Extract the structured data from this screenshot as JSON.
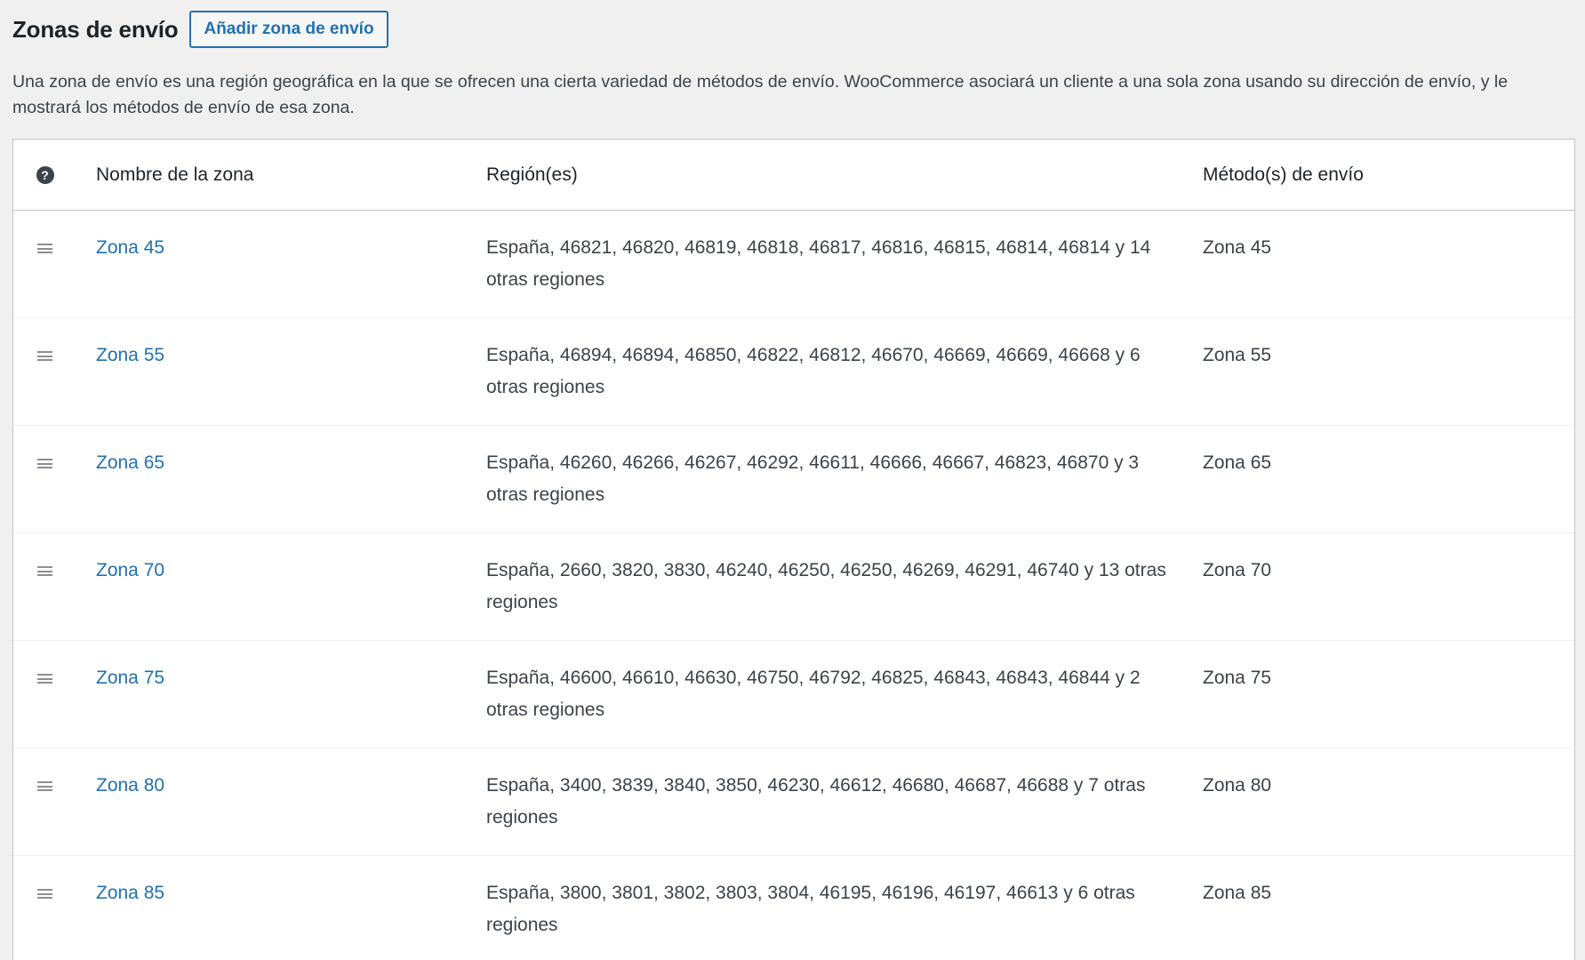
{
  "header": {
    "title": "Zonas de envío",
    "add_button_label": "Añadir zona de envío"
  },
  "description": "Una zona de envío es una región geográfica en la que se ofrecen una cierta variedad de métodos de envío. WooCommerce asociará un cliente a una sola zona usando su dirección de envío, y le mostrará los métodos de envío de esa zona.",
  "table": {
    "help_icon": "question-circle-icon",
    "columns": {
      "name": "Nombre de la zona",
      "region": "Región(es)",
      "method": "Método(s) de envío"
    },
    "rows": [
      {
        "name": "Zona 45",
        "region": "España, 46821, 46820, 46819, 46818, 46817, 46816, 46815, 46814, 46814 y 14 otras regiones",
        "method": "Zona 45"
      },
      {
        "name": "Zona 55",
        "region": "España, 46894, 46894, 46850, 46822, 46812, 46670, 46669, 46669, 46668 y 6 otras regiones",
        "method": "Zona 55"
      },
      {
        "name": "Zona 65",
        "region": "España, 46260, 46266, 46267, 46292, 46611, 46666, 46667, 46823, 46870 y 3 otras regiones",
        "method": "Zona 65"
      },
      {
        "name": "Zona 70",
        "region": "España, 2660, 3820, 3830, 46240, 46250, 46250, 46269, 46291, 46740 y 13 otras regiones",
        "method": "Zona 70"
      },
      {
        "name": "Zona 75",
        "region": "España, 46600, 46610, 46630, 46750, 46792, 46825, 46843, 46843, 46844 y 2 otras regiones",
        "method": "Zona 75"
      },
      {
        "name": "Zona 80",
        "region": "España, 3400, 3839, 3840, 3850, 46230, 46612, 46680, 46687, 46688 y 7 otras regiones",
        "method": "Zona 80"
      },
      {
        "name": "Zona 85",
        "region": "España, 3800, 3801, 3802, 3803, 3804, 46195, 46196, 46197, 46613 y 6 otras regiones",
        "method": "Zona 85"
      }
    ]
  }
}
